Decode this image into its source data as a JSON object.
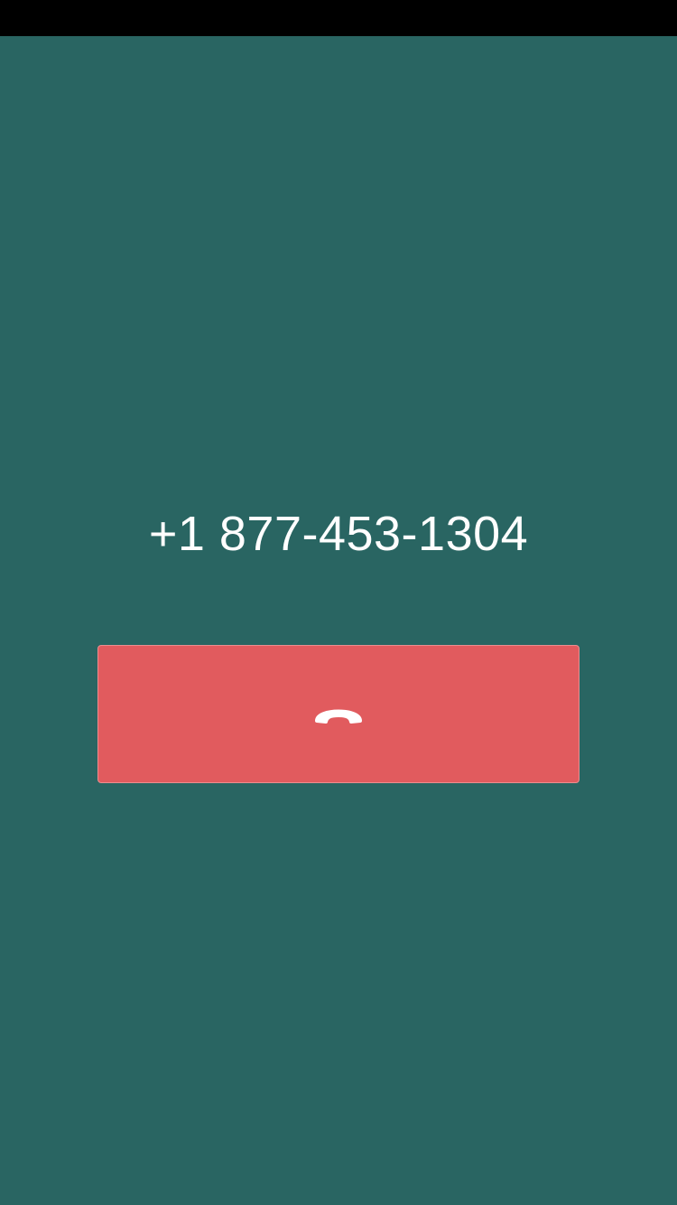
{
  "call": {
    "number": "+1 877-453-1304"
  },
  "end_call_button": {
    "icon": "phone-hangup-icon"
  },
  "colors": {
    "background": "#296562",
    "status_bar": "#000000",
    "end_call": "#e15b5e",
    "text": "#ffffff"
  }
}
